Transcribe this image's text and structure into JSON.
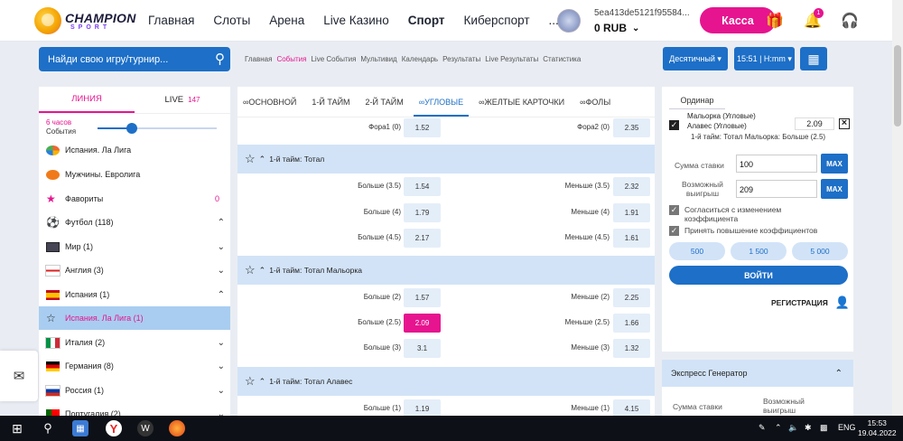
{
  "header": {
    "logo_main": "CHAMPION",
    "logo_sub": "SPORT",
    "nav": [
      "Главная",
      "Слоты",
      "Арена",
      "Live Казино",
      "Спорт",
      "Киберспорт",
      "..."
    ],
    "user_id": "5ea413de5121f95584...",
    "balance": "0 RUB",
    "kassa_label": "Касса",
    "notif_count": "1"
  },
  "search": {
    "placeholder": "Найди свою игру/турнир..."
  },
  "breadcrumbs": [
    "Главная",
    "События",
    "Live События",
    "Мультивид",
    "Календарь",
    "Результаты",
    "Live Результаты",
    "Статистика"
  ],
  "breadcrumbs_active": "События",
  "selectors": {
    "odds_format": "Десятичный",
    "time_format": "15:51 | H:mm"
  },
  "left": {
    "tab_line": "ЛИНИЯ",
    "tab_live": "LIVE",
    "live_count": "147",
    "hours_label": "6 часов",
    "events_label": "События",
    "slider_fraction": 0.25,
    "items": [
      {
        "label": "Испания. Ла Лига",
        "icon": "laliga-icon"
      },
      {
        "label": "Мужчины. Евролига",
        "icon": "basketball-icon"
      },
      {
        "label": "Фавориты",
        "icon": "star-icon",
        "count": "0"
      },
      {
        "label": "Футбол (118)",
        "icon": "football-icon"
      },
      {
        "label": "Мир (1)",
        "icon": "world-flag"
      },
      {
        "label": "Англия (3)",
        "icon": "england-flag"
      },
      {
        "label": "Испания (1)",
        "icon": "spain-flag"
      },
      {
        "label": "Испания. Ла Лига (1)",
        "icon": "star-outline-icon"
      },
      {
        "label": "Италия (2)",
        "icon": "italy-flag"
      },
      {
        "label": "Германия (8)",
        "icon": "germany-flag"
      },
      {
        "label": "Россия (1)",
        "icon": "russia-flag"
      },
      {
        "label": "Португалия (2)",
        "icon": "portugal-flag"
      }
    ]
  },
  "markets": {
    "tabs": [
      "ОСНОВНОЙ",
      "1-Й ТАЙМ",
      "2-Й ТАЙМ",
      "УГЛОВЫЕ",
      "ЖЕЛТЫЕ КАРТОЧКИ",
      "ФОЛЫ"
    ],
    "active_tab": "УГЛОВЫЕ",
    "top_row": {
      "left_name": "Фора1 (0)",
      "left_val": "1.52",
      "right_name": "Фора2 (0)",
      "right_val": "2.35"
    },
    "sections": [
      {
        "title": "1-й тайм: Тотал",
        "rows": [
          {
            "ln": "Больше (3.5)",
            "lv": "1.54",
            "rn": "Меньше (3.5)",
            "rv": "2.32"
          },
          {
            "ln": "Больше (4)",
            "lv": "1.79",
            "rn": "Меньше (4)",
            "rv": "1.91"
          },
          {
            "ln": "Больше (4.5)",
            "lv": "2.17",
            "rn": "Меньше (4.5)",
            "rv": "1.61"
          }
        ]
      },
      {
        "title": "1-й тайм: Тотал Мальорка",
        "rows": [
          {
            "ln": "Больше (2)",
            "lv": "1.57",
            "rn": "Меньше (2)",
            "rv": "2.25"
          },
          {
            "ln": "Больше (2.5)",
            "lv": "2.09",
            "rn": "Меньше (2.5)",
            "rv": "1.66",
            "selected": true
          },
          {
            "ln": "Больше (3)",
            "lv": "3.1",
            "rn": "Меньше (3)",
            "rv": "1.32"
          }
        ]
      },
      {
        "title": "1-й тайм: Тотал Алавес",
        "rows": [
          {
            "ln": "Больше (1)",
            "lv": "1.19",
            "rn": "Меньше (1)",
            "rv": "4.15"
          }
        ]
      }
    ]
  },
  "betslip": {
    "tab": "Ординар",
    "team1": "Мальорка (Угловые)",
    "team2": "Алавес (Угловые)",
    "coef": "2.09",
    "market": "1-й тайм: Тотал Мальорка: Больше (2.5)",
    "stake_label": "Сумма ставки",
    "stake_value": "100",
    "win_label_1": "Возможный",
    "win_label_2": "выигрыш",
    "win_value": "209",
    "max_label": "MAX",
    "agree_1a": "Согласиться с изменением",
    "agree_1b": "коэффициента",
    "agree_2": "Принять повышение коэффициентов",
    "quick": [
      "500",
      "1 500",
      "5 000"
    ],
    "login": "ВОЙТИ",
    "register": "РЕГИСТРАЦИЯ"
  },
  "express": {
    "title": "Экспресс Генератор",
    "stake_label": "Сумма ставки",
    "win_label_1": "Возможный",
    "win_label_2": "выигрыш"
  },
  "taskbar": {
    "lang": "ENG",
    "time": "15:53",
    "date": "19.04.2022"
  }
}
